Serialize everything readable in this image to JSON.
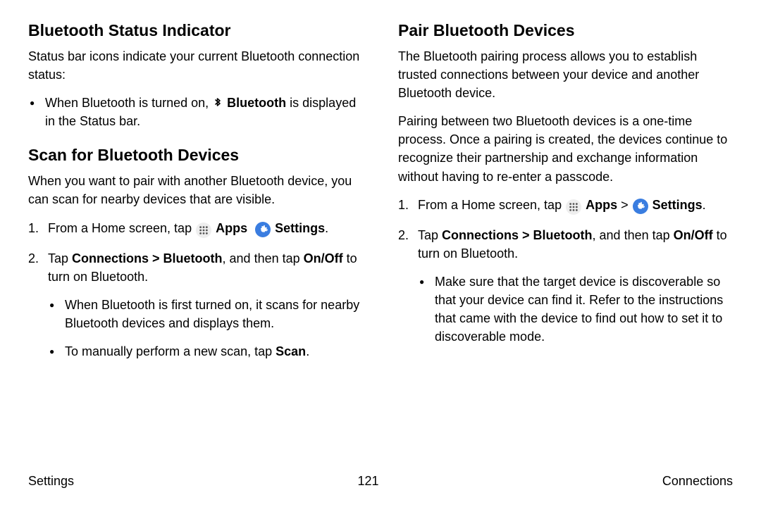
{
  "left": {
    "h_bsi": "Bluetooth Status Indicator",
    "p_bsi": "Status bar icons indicate your current Bluetooth connection status:",
    "bsi_bullet_pre": "When Bluetooth is turned on, ",
    "bsi_bullet_bold": "Bluetooth",
    "bsi_bullet_post": " is displayed in the Status bar.",
    "h_scan": "Scan for Bluetooth Devices",
    "p_scan": "When you want to pair with another Bluetooth device, you can scan for nearby devices that are visible.",
    "step1_pre": "From a Home screen, tap ",
    "step1_apps": "Apps",
    "step1_settings": "Settings",
    "step1_end": ".",
    "step2_pre": "Tap ",
    "step2_bold1": "Connections > Bluetooth",
    "step2_mid": ", and then tap ",
    "step2_bold2": "On/Off",
    "step2_post": " to turn on Bluetooth.",
    "sub1": "When Bluetooth is first turned on, it scans for nearby Bluetooth devices and displays them.",
    "sub2_pre": "To manually perform a new scan, tap ",
    "sub2_bold": "Scan",
    "sub2_post": "."
  },
  "right": {
    "h_pair": "Pair Bluetooth Devices",
    "p_pair1": "The Bluetooth pairing process allows you to establish trusted connections between your device and another Bluetooth device.",
    "p_pair2": "Pairing between two Bluetooth devices is a one-time process. Once a pairing is created, the devices continue to recognize their partnership and exchange information without having to re-enter a passcode.",
    "step1_pre": "From a Home screen, tap ",
    "step1_apps": "Apps",
    "step1_gt": " > ",
    "step1_settings": "Settings",
    "step1_end": ".",
    "step2_pre": "Tap ",
    "step2_bold1": "Connections > Bluetooth",
    "step2_mid": ", and then tap ",
    "step2_bold2": "On/Off",
    "step2_post": " to turn on Bluetooth.",
    "sub1": "Make sure that the target device is discoverable so that your device can find it. Refer to the instructions that came with the device to find out how to set it to discoverable mode."
  },
  "footer": {
    "left": "Settings",
    "center": "121",
    "right": "Connections"
  }
}
